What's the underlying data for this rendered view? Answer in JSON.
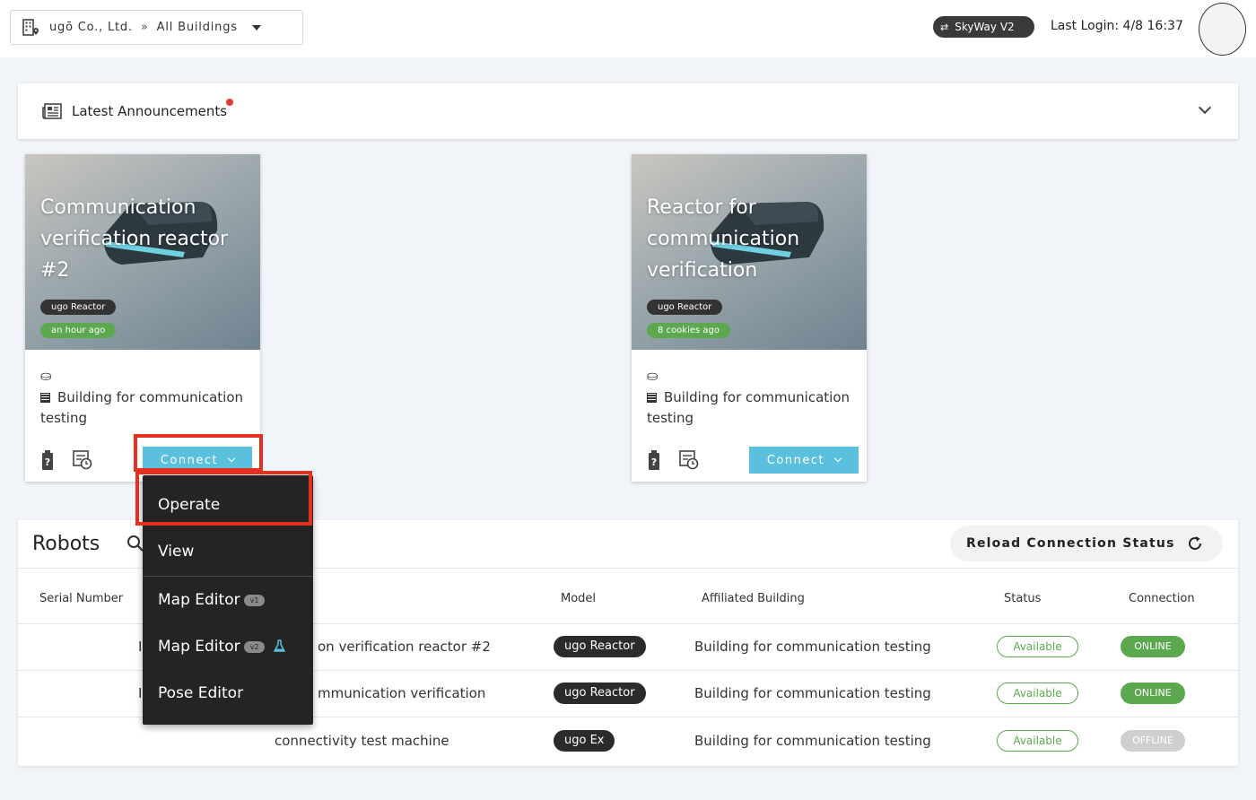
{
  "header": {
    "org": "ugō Co., Ltd.",
    "separator": "»",
    "buildings_filter": "All Buildings",
    "skyway_label": "SkyWay V2",
    "last_login": "Last Login: 4/8 16:37"
  },
  "announcements": {
    "title": "Latest Announcements"
  },
  "cards": [
    {
      "title": "Communication verification reactor #2",
      "model": "ugo Reactor",
      "time": "an hour ago",
      "building": "Building for communication testing",
      "connect_label": "Connect"
    },
    {
      "title": "Reactor for communication verification",
      "model": "ugo Reactor",
      "time": "8 cookies ago",
      "building": "Building for communication testing",
      "connect_label": "Connect"
    }
  ],
  "connect_menu": {
    "items": [
      {
        "label": "Operate"
      },
      {
        "label": "View"
      },
      {
        "label": "Map Editor",
        "badge": "v1"
      },
      {
        "label": "Map Editor",
        "badge": "v2"
      },
      {
        "label": "Pose Editor"
      }
    ]
  },
  "robots": {
    "title": "Robots",
    "reload_label": "Reload Connection Status",
    "columns": [
      "Serial Number",
      "Model",
      "Affiliated Building",
      "Status",
      "Connection"
    ],
    "rows": [
      {
        "serial_fragment": "I",
        "name": "on verification reactor #2",
        "model": "ugo Reactor",
        "building": "Building for communication testing",
        "status": "Available",
        "connection": "ONLINE"
      },
      {
        "serial_fragment": "I",
        "name": "mmunication verification",
        "model": "ugo Reactor",
        "building": "Building for communication testing",
        "status": "Available",
        "connection": "ONLINE"
      },
      {
        "serial_fragment": "",
        "name": "connectivity test machine",
        "model": "ugo Ex",
        "building": "Building for communication testing",
        "status": "Available",
        "connection": "OFFLINE"
      }
    ]
  },
  "colors": {
    "connect": "#5bc0de",
    "online": "#5ba84f",
    "offline": "#cfcfcf",
    "highlight": "#e53020",
    "menu_bg": "#242424"
  }
}
